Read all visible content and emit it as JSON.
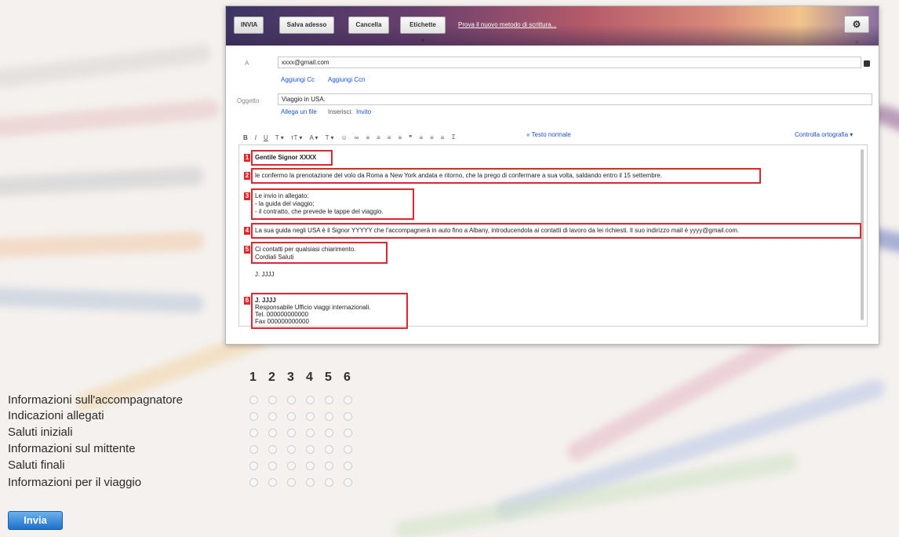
{
  "compose": {
    "toolbar": {
      "send_label": "INVIA",
      "save_label": "Salva adesso",
      "cancel_label": "Cancella",
      "labels_label": "Etichette ▾",
      "promo_text": "Prova il nuovo metodo di scrittura..."
    },
    "to": {
      "label": "A",
      "value": "xxxx@gmail.com",
      "add_cc": "Aggiungi Cc",
      "add_bcc": "Aggiungi Ccn"
    },
    "subject": {
      "label": "Oggetto",
      "value": "Viaggio in USA.",
      "attach": "Allega un file",
      "insert": "Inserisci:",
      "invite": "Invito"
    },
    "formatting": {
      "plain_text": "« Testo normale",
      "spell_check": "Controlla ortografia ▾"
    },
    "body": {
      "greeting": "Gentile Signor XXXX",
      "confirmation": "le confermo la prenotazione del volo da Roma a New York andata e ritorno, che la prego di confermare a sua volta, saldando entro il 15 settembre.",
      "attachments": [
        "Le invio in allegato:",
        "- la guida del viaggio;",
        "- il contratto, che prevede le tappe del viaggio."
      ],
      "guide_info": "La sua guida negli USA è il Signor YYYYY che l'accompagnerà in auto fino a Albany, introducendola ai contatti di lavoro da lei richiesti. Il suo indirizzo mail è yyyy@gmail.com.",
      "closing": [
        "Ci contatti per qualsiasi chiarimento.",
        "Cordiali Saluti"
      ],
      "sign_name": "J. JJJJ",
      "signature": [
        "J. JJJJ",
        "Responsabile Ufficio viaggi internazionali.",
        "Tel. 000000000000",
        "Fax 000000000000"
      ],
      "markers": [
        "1",
        "2",
        "3",
        "4",
        "5",
        "6"
      ]
    }
  },
  "quiz": {
    "columns": [
      "1",
      "2",
      "3",
      "4",
      "5",
      "6"
    ],
    "rows": [
      "Informazioni sull'accompagnatore",
      "Indicazioni allegati",
      "Saluti iniziali",
      "Informazioni sul mittente",
      "Saluti finali",
      "Informazioni per il viaggio"
    ],
    "submit_label": "Invia"
  },
  "colors": {
    "highlight": "#e3262b",
    "link": "#1a55c4",
    "submit": "#1d6fc9"
  }
}
